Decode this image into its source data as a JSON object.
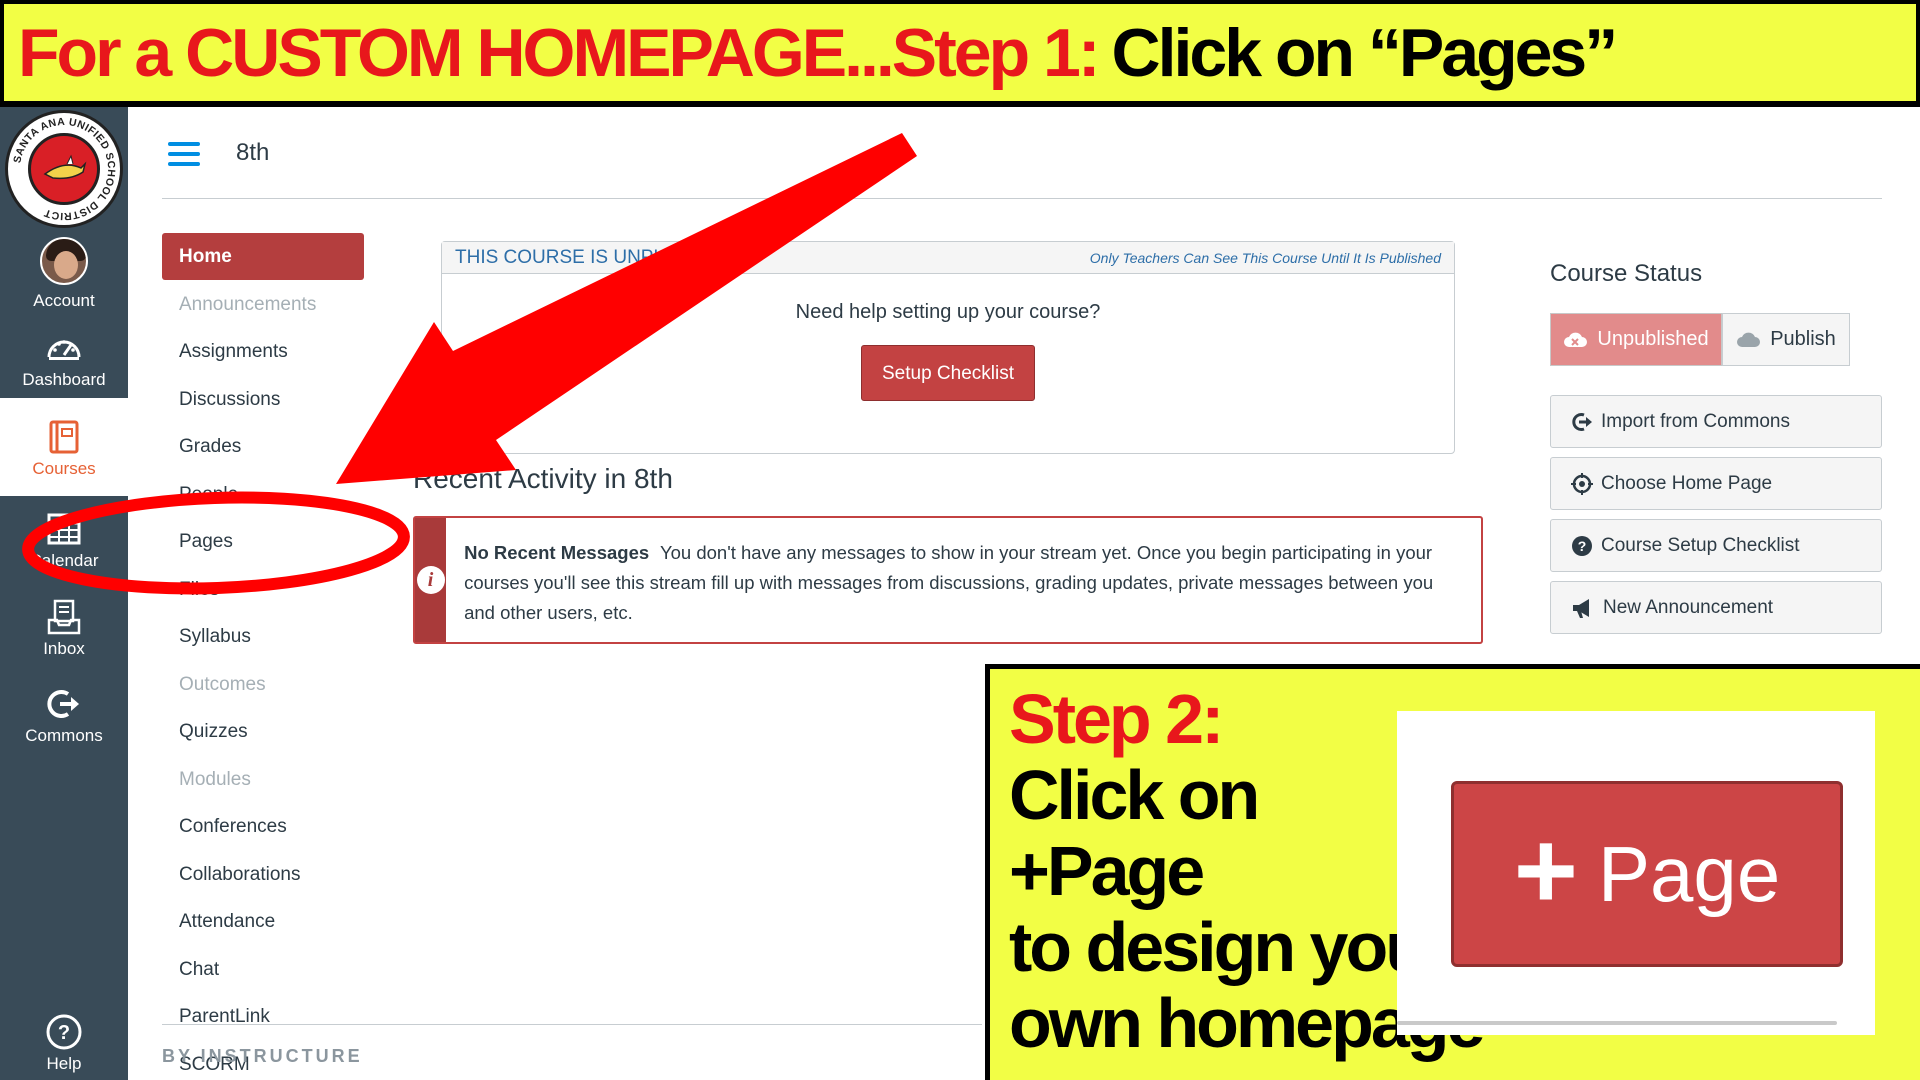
{
  "banner": {
    "red_text": "For a CUSTOM HOMEPAGE...Step 1:",
    "black_text": "Click on “Pages”"
  },
  "global_nav": {
    "items": [
      {
        "label": "Account",
        "icon": "avatar"
      },
      {
        "label": "Dashboard",
        "icon": "dashboard-icon"
      },
      {
        "label": "Courses",
        "icon": "courses-icon",
        "active": true
      },
      {
        "label": "Calendar",
        "icon": "calendar-icon"
      },
      {
        "label": "Inbox",
        "icon": "inbox-icon"
      },
      {
        "label": "Commons",
        "icon": "commons-icon"
      }
    ],
    "help_label": "Help",
    "logo_text": "SANTA ANA UNIFIED SCHOOL DISTRICT"
  },
  "header": {
    "breadcrumb": "8th"
  },
  "course_nav": {
    "items": [
      {
        "label": "Home",
        "state": "active"
      },
      {
        "label": "Announcements",
        "state": "disabled"
      },
      {
        "label": "Assignments",
        "state": "enabled"
      },
      {
        "label": "Discussions",
        "state": "enabled"
      },
      {
        "label": "Grades",
        "state": "enabled"
      },
      {
        "label": "People",
        "state": "enabled"
      },
      {
        "label": "Pages",
        "state": "enabled"
      },
      {
        "label": "Files",
        "state": "enabled"
      },
      {
        "label": "Syllabus",
        "state": "enabled"
      },
      {
        "label": "Outcomes",
        "state": "disabled"
      },
      {
        "label": "Quizzes",
        "state": "enabled"
      },
      {
        "label": "Modules",
        "state": "disabled"
      },
      {
        "label": "Conferences",
        "state": "enabled"
      },
      {
        "label": "Collaborations",
        "state": "enabled"
      },
      {
        "label": "Attendance",
        "state": "enabled"
      },
      {
        "label": "Chat",
        "state": "enabled"
      },
      {
        "label": "ParentLink",
        "state": "enabled"
      },
      {
        "label": "SCORM",
        "state": "enabled"
      }
    ]
  },
  "unpublished": {
    "title": "THIS COURSE IS UNPUBLISHED",
    "note": "Only Teachers Can See This Course Until It Is Published",
    "question": "Need help setting up your course?",
    "setup_button": "Setup Checklist"
  },
  "recent_activity": {
    "title": "Recent Activity in 8th",
    "message_title": "No Recent Messages",
    "message_body": "You don't have any messages to show in your stream yet. Once you begin participating in your courses you'll see this stream fill up with messages from discussions, grading updates, private messages between you and other users, etc."
  },
  "course_status": {
    "title": "Course Status",
    "unpublished_label": "Unpublished",
    "publish_label": "Publish",
    "actions": [
      {
        "label": "Import from Commons",
        "icon": "commons-icon"
      },
      {
        "label": "Choose Home Page",
        "icon": "target-icon"
      },
      {
        "label": "Course Setup Checklist",
        "icon": "question-icon"
      },
      {
        "label": "New Announcement",
        "icon": "megaphone-icon"
      }
    ]
  },
  "footer": {
    "brand": "BY INSTRUCTURE"
  },
  "step2": {
    "heading": "Step 2:",
    "lines": [
      "Click on",
      "+Page",
      "to design your",
      "own homepage"
    ],
    "button_plus": "+",
    "button_label": "Page"
  },
  "colors": {
    "banner_bg": "#f2fe45",
    "banner_red": "#e8171c",
    "nav_bg": "#394b58",
    "home_bg": "#b43e3e",
    "arrow_red": "#ff0000"
  }
}
